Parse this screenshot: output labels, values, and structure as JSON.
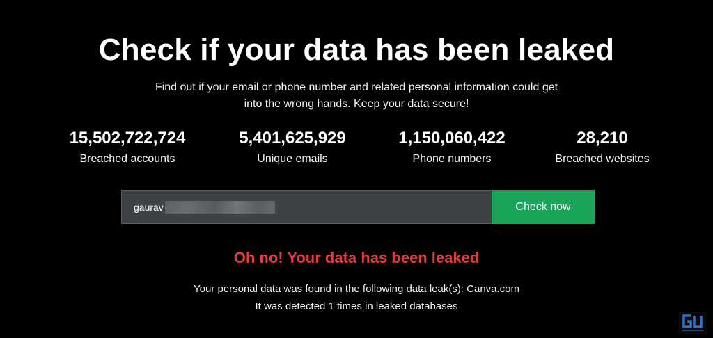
{
  "header": {
    "title": "Check if your data has been leaked",
    "subtitle_line1": "Find out if your email or phone number and related personal information could get",
    "subtitle_line2": "into the wrong hands. Keep your data secure!"
  },
  "stats": [
    {
      "value": "15,502,722,724",
      "label": "Breached accounts"
    },
    {
      "value": "5,401,625,929",
      "label": "Unique emails"
    },
    {
      "value": "1,150,060,422",
      "label": "Phone numbers"
    },
    {
      "value": "28,210",
      "label": "Breached websites"
    }
  ],
  "search": {
    "value_visible": "gaurav",
    "button_label": "Check now",
    "input_background": "#3f4245",
    "button_color": "#19a45a"
  },
  "result": {
    "title": "Oh no! Your data has been leaked",
    "line1": "Your personal data was found in the following data leak(s): Canva.com",
    "line2": "It was detected 1 times in leaked databases",
    "alert_color": "#e43a3c"
  },
  "watermark": {
    "text": "GU",
    "icon": "watermark-logo-icon"
  }
}
